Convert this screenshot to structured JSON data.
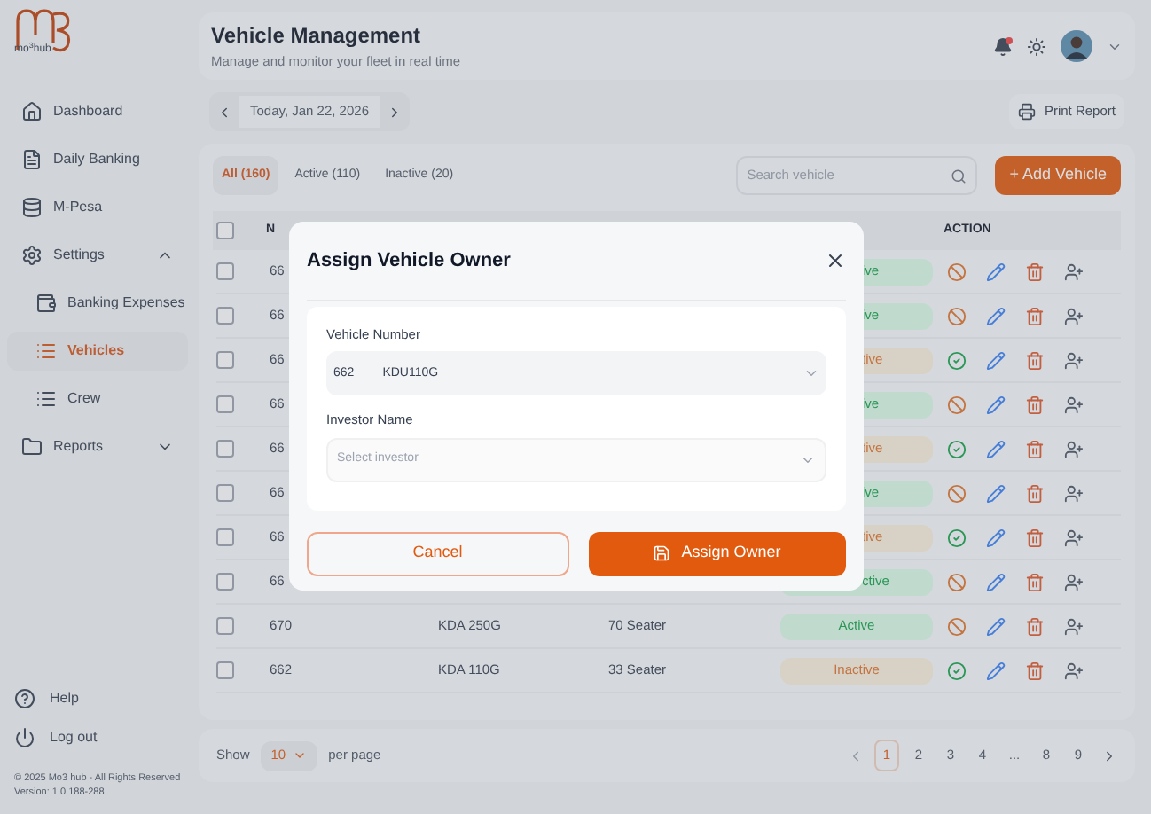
{
  "sidebar": {
    "logo_text": "mo$^{3}$hub",
    "items": [
      {
        "label": "Dashboard",
        "selected": false
      },
      {
        "label": "Daily Banking",
        "selected": false
      },
      {
        "label": "M-Pesa",
        "selected": false
      },
      {
        "label": "Settings",
        "selected": false,
        "expanded": true,
        "children": [
          {
            "label": "Banking Expenses",
            "selected": false
          },
          {
            "label": "Vehicles",
            "selected": true
          },
          {
            "label": "Crew",
            "selected": false
          }
        ]
      },
      {
        "label": "Reports",
        "selected": false,
        "expanded": false
      }
    ],
    "bottom": [
      {
        "label": "Help"
      },
      {
        "label": "Log out"
      }
    ],
    "copyright": "© 2025 Mo3 hub - All Rights Reserved",
    "version": "Version: 1.0.188-288"
  },
  "header": {
    "title": "Vehicle Management",
    "subtitle": "Manage and monitor your fleet in real time",
    "notification": true
  },
  "date_nav": {
    "label": "Today, Jan 22, 2026"
  },
  "print_button": "Print Report",
  "tabs": [
    {
      "label": "All (160)",
      "selected": true
    },
    {
      "label": "Active (110)",
      "selected": false
    },
    {
      "label": "Inactive (20)",
      "selected": false
    }
  ],
  "search": {
    "placeholder": "Search vehicle"
  },
  "add_button": "+ Add Vehicle",
  "table": {
    "columns": [
      "N",
      "ACTION"
    ],
    "select_all": {
      "checked": false
    },
    "rows": [
      {
        "number": "66",
        "kind": "active",
        "status_text": "ive",
        "partial": true,
        "checked": false
      },
      {
        "number": "66",
        "kind": "active",
        "status_text": "ive",
        "partial": true,
        "checked": false
      },
      {
        "number": "66",
        "kind": "inactive",
        "status_text": "tive",
        "partial": true,
        "checked": false
      },
      {
        "number": "66",
        "kind": "active",
        "status_text": "ive",
        "partial": true,
        "checked": false
      },
      {
        "number": "66",
        "kind": "inactive",
        "status_text": "tive",
        "partial": true,
        "checked": false
      },
      {
        "number": "66",
        "kind": "active",
        "status_text": "ive",
        "partial": true,
        "checked": false
      },
      {
        "number": "66",
        "kind": "inactive",
        "status_text": "tive",
        "partial": true,
        "checked": false
      },
      {
        "number": "66",
        "kind": "active",
        "status_text": "ctive",
        "partial": true,
        "checked": false
      },
      {
        "number": "670",
        "registration": "KDA 250G",
        "capacity": "70 Seater",
        "kind": "active",
        "status_text": "Active",
        "partial": false,
        "checked": false
      },
      {
        "number": "662",
        "registration": "KDA 110G",
        "capacity": "33 Seater",
        "kind": "inactive",
        "status_text": "Inactive",
        "partial": false,
        "checked": false
      }
    ]
  },
  "pagination": {
    "show_label": "Show",
    "page_size": "10",
    "per_page_label": "per page",
    "pages": [
      {
        "label": "1",
        "selected": true
      },
      {
        "label": "2",
        "selected": false
      },
      {
        "label": "3",
        "selected": false
      },
      {
        "label": "4",
        "selected": false
      },
      {
        "label": "...",
        "selected": false
      },
      {
        "label": "8",
        "selected": false
      },
      {
        "label": "9",
        "selected": false
      }
    ]
  },
  "modal": {
    "title": "Assign Vehicle Owner",
    "fields": [
      {
        "label": "Vehicle Number",
        "kind": "vehicle",
        "prefix": "662",
        "value": "KDU110G"
      },
      {
        "label": "Investor Name",
        "kind": "select",
        "placeholder": "Select investor"
      }
    ],
    "cancel": "Cancel",
    "confirm": "Assign Owner"
  }
}
